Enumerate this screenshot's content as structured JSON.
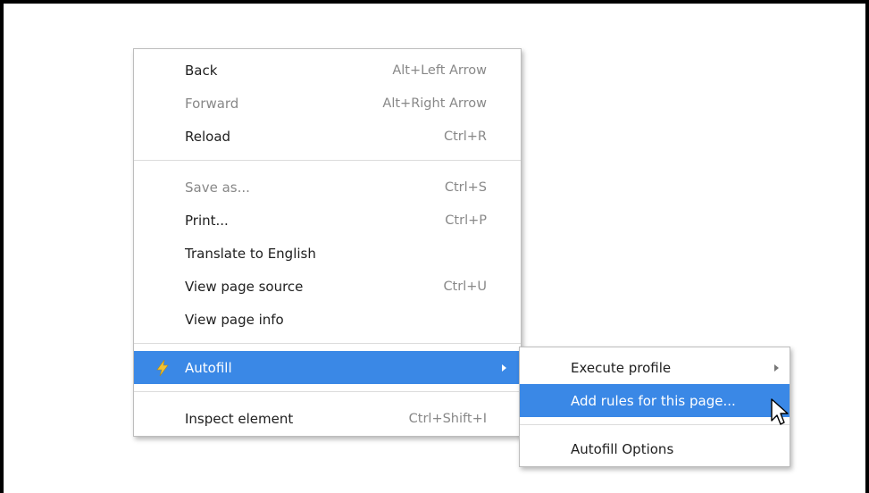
{
  "context_menu": {
    "items": [
      {
        "label": "Back",
        "shortcut": "Alt+Left Arrow",
        "disabled": false
      },
      {
        "label": "Forward",
        "shortcut": "Alt+Right Arrow",
        "disabled": true
      },
      {
        "label": "Reload",
        "shortcut": "Ctrl+R",
        "disabled": false
      },
      {
        "label": "Save as...",
        "shortcut": "Ctrl+S",
        "disabled": true
      },
      {
        "label": "Print...",
        "shortcut": "Ctrl+P",
        "disabled": false
      },
      {
        "label": "Translate to English",
        "shortcut": "",
        "disabled": false
      },
      {
        "label": "View page source",
        "shortcut": "Ctrl+U",
        "disabled": false
      },
      {
        "label": "View page info",
        "shortcut": "",
        "disabled": false
      },
      {
        "label": "Autofill",
        "shortcut": "",
        "disabled": false,
        "highlighted": true,
        "icon": "autofill-lightning-icon",
        "has_submenu": true
      },
      {
        "label": "Inspect element",
        "shortcut": "Ctrl+Shift+I",
        "disabled": false
      }
    ]
  },
  "autofill_submenu": {
    "items": [
      {
        "label": "Execute profile",
        "has_submenu": true
      },
      {
        "label": "Add rules for this page...",
        "highlighted": true
      },
      {
        "label": "Autofill Options"
      }
    ]
  },
  "colors": {
    "highlight": "#3a88e6",
    "icon_fill": "#f2c230",
    "disabled_text": "#888888"
  },
  "cursor": "pointer-arrow-icon"
}
